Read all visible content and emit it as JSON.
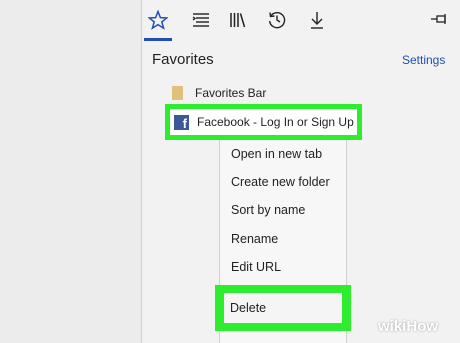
{
  "colors": {
    "accent": "#1f4fb4",
    "highlight": "#2eec2e",
    "facebook": "#3b5998",
    "folder": "#e2c07c"
  },
  "hub": {
    "tabs": [
      {
        "icon": "star-icon"
      },
      {
        "icon": "reading-list-icon"
      },
      {
        "icon": "books-icon"
      },
      {
        "icon": "history-icon"
      },
      {
        "icon": "download-icon"
      }
    ],
    "pin_icon": "pin-icon",
    "title": "Favorites",
    "settings": "Settings"
  },
  "favorites": [
    {
      "label": "Favorites Bar",
      "icon": "folder-icon"
    },
    {
      "label": "Facebook - Log In or Sign Up",
      "icon": "facebook-icon",
      "icon_glyph": "f"
    }
  ],
  "context_menu": {
    "items": [
      "Open in new tab",
      "Create new folder",
      "Sort by name",
      "Rename",
      "Edit URL",
      "Delete"
    ]
  },
  "watermark": {
    "wiki": "wiki",
    "how": "How"
  }
}
